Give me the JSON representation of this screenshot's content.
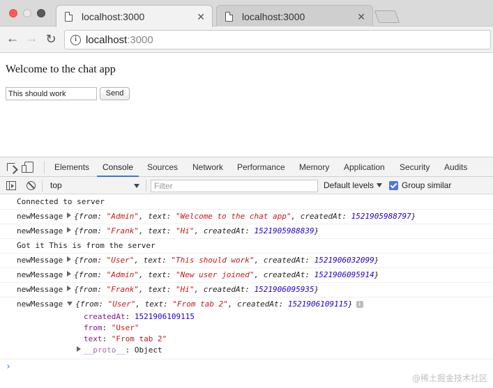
{
  "browser": {
    "tabs": [
      {
        "title": "localhost:3000",
        "close": "✕"
      },
      {
        "title": "localhost:3000",
        "close": "✕"
      }
    ],
    "nav": {
      "back": "←",
      "forward": "→",
      "reload": "↻"
    },
    "url": {
      "host": "localhost",
      "port": ":3000"
    }
  },
  "page": {
    "heading": "Welcome to the chat app",
    "message_input_value": "This should work",
    "send_label": "Send"
  },
  "devtools": {
    "tabs": [
      "Elements",
      "Console",
      "Sources",
      "Network",
      "Performance",
      "Memory",
      "Application",
      "Security",
      "Audits"
    ],
    "active_tab": "Console",
    "context": "top",
    "filter_placeholder": "Filter",
    "levels_label": "Default levels",
    "group_similar_label": "Group similar",
    "group_similar_checked": true,
    "accent_color": "#3d78d6"
  },
  "console": {
    "logs": [
      {
        "type": "text",
        "text": "Connected to server"
      },
      {
        "type": "object",
        "prefix": "newMessage",
        "from": "\"Admin\"",
        "text": "\"Welcome to the chat app\"",
        "createdAt": "1521905988797"
      },
      {
        "type": "object",
        "prefix": "newMessage",
        "from": "\"Frank\"",
        "text": "\"Hi\"",
        "createdAt": "1521905988839"
      },
      {
        "type": "text",
        "text": "Got it This is from the server"
      },
      {
        "type": "object",
        "prefix": "newMessage",
        "from": "\"User\"",
        "text": "\"This should work\"",
        "createdAt": "1521906032099"
      },
      {
        "type": "object",
        "prefix": "newMessage",
        "from": "\"Admin\"",
        "text": "\"New user joined\"",
        "createdAt": "1521906095914"
      },
      {
        "type": "object",
        "prefix": "newMessage",
        "from": "\"Frank\"",
        "text": "\"Hi\"",
        "createdAt": "1521906095935"
      }
    ],
    "expanded": {
      "prefix": "newMessage",
      "from": "\"User\"",
      "text": "\"From tab 2\"",
      "createdAt": "1521906109115",
      "props": [
        {
          "key": "createdAt",
          "value": "1521906109115",
          "kind": "number"
        },
        {
          "key": "from",
          "value": "\"User\"",
          "kind": "string"
        },
        {
          "key": "text",
          "value": "\"From tab 2\"",
          "kind": "string"
        }
      ],
      "proto_key": "__proto__",
      "proto_value": "Object"
    },
    "prompt": "›"
  },
  "watermark": "@稀土掘金技术社区"
}
